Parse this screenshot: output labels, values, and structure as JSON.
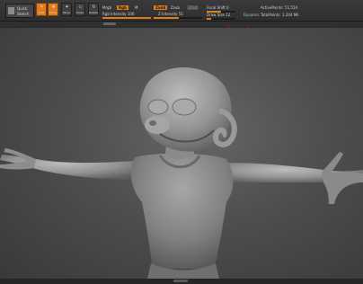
{
  "toolbar": {
    "quick_sketch": [
      "Quick",
      "Sketch"
    ],
    "tools": [
      {
        "glyph": "✎",
        "label": "Edit",
        "active": true
      },
      {
        "glyph": "✥",
        "label": "Draw",
        "active": true
      },
      {
        "glyph": "✦",
        "label": "Move",
        "active": false
      },
      {
        "glyph": "◇",
        "label": "Scale",
        "active": false
      },
      {
        "glyph": "↻",
        "label": "Rotate",
        "active": false
      }
    ],
    "mrgb": "Mrgb",
    "rgb": "Rgb",
    "m": "M",
    "rgb_intensity_label": "Rgb Intensity",
    "rgb_intensity": "100",
    "zadd": "Zadd",
    "zsub": "Zsub",
    "zcut": "Zcut",
    "z_intensity_label": "Z Intensity",
    "z_intensity": "51",
    "focal_shift_label": "Focal Shift",
    "focal_shift": "0",
    "draw_size_label": "Draw Size",
    "draw_size": "12",
    "dynamic": "Dynamic",
    "active_points_label": "ActivePoints:",
    "active_points": "51,554",
    "total_points_label": "TotalPoints:",
    "total_points": "1.204 Mil"
  },
  "levels": {
    "rgb_intensity": 1.0,
    "z_intensity": 0.51,
    "draw_size": 0.12
  },
  "colors": {
    "accent": "#e07a1c",
    "viewport_bg": "#4e4e4e",
    "model": "#9a9a9a"
  }
}
